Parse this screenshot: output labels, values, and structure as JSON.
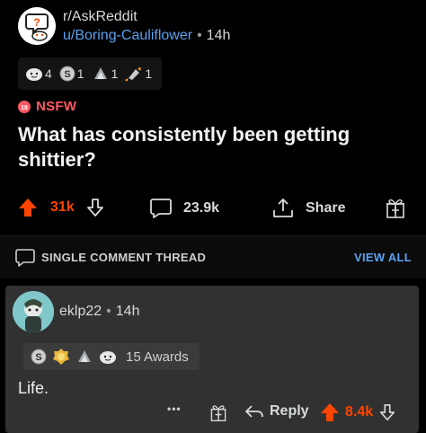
{
  "post": {
    "subreddit": "r/AskReddit",
    "user": "u/Boring-Cauliflower",
    "separator": "•",
    "time": "14h",
    "awards": [
      {
        "icon": "wholesome-award-icon",
        "count": "4"
      },
      {
        "icon": "silver-award-icon",
        "count": "1"
      },
      {
        "icon": "helpful-award-icon",
        "count": "1"
      },
      {
        "icon": "rocket-like-award-icon",
        "count": "1"
      }
    ],
    "nsfw_label": "NSFW",
    "title": "What has consistently been getting shittier?",
    "score": "31k",
    "comments": "23.9k",
    "share_label": "Share"
  },
  "thread": {
    "label": "SINGLE COMMENT THREAD",
    "view_all": "VIEW ALL"
  },
  "comment": {
    "user": "eklp22",
    "separator": "•",
    "time": "14h",
    "awards_label": "15 Awards",
    "body": "Life.",
    "more": "•••",
    "reply_label": "Reply",
    "score": "8.4k"
  },
  "colors": {
    "background": "#000000",
    "upvote": "#ff4500",
    "link": "#5aa1f0",
    "nsfw": "#ff5864",
    "comment_bg": "#313131"
  }
}
